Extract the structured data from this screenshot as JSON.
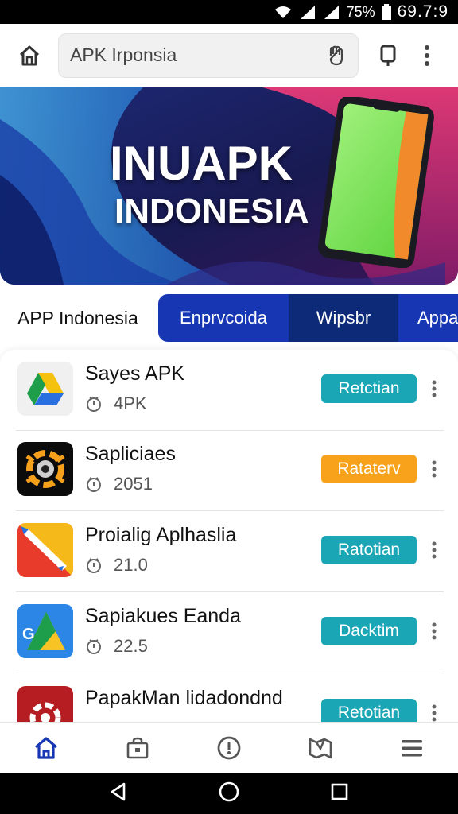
{
  "status_bar": {
    "battery": "75%",
    "time": "69.7:9"
  },
  "browser": {
    "url_text": "APK Irponsia"
  },
  "banner": {
    "title_line1": "INUAPK",
    "title_line2": "INDONESIA",
    "colors": {
      "bg_dark": "#1b1d5c",
      "wave_blue": "#2a8fe0",
      "pink": "#e8306e",
      "phone_screen": "#7fe05c"
    }
  },
  "tabs": {
    "section_label": "APP Indonesia",
    "items": [
      "Enprvcoida",
      "Wipsbr",
      "Appa"
    ]
  },
  "apps": [
    {
      "name": "Sayes APK",
      "meta": "4PK",
      "action": "Retctian",
      "action_color": "#1aa6b5",
      "icon": "drive-triangle-icon"
    },
    {
      "name": "Sapliciaes",
      "meta": "2051",
      "action": "Rataterv",
      "action_color": "#f7a21a",
      "icon": "orange-gear-icon"
    },
    {
      "name": "Proialig Aplhaslia",
      "meta": "21.0",
      "action": "Ratotian",
      "action_color": "#1aa6b5",
      "icon": "pencil-note-icon"
    },
    {
      "name": "Sapiakues Eanda",
      "meta": "22.5",
      "action": "Dacktim",
      "action_color": "#1aa6b5",
      "icon": "maps-g-icon"
    },
    {
      "name": "PapakMan lidadondnd",
      "meta": "",
      "action": "Retotian",
      "action_color": "#1aa6b5",
      "icon": "red-gear-icon"
    }
  ],
  "bottom_nav": [
    "home-icon",
    "shopping-bag-icon",
    "compass-icon",
    "map-icon",
    "hamburger-menu-icon"
  ],
  "colors": {
    "accent_blue": "#1636b4",
    "teal": "#1aa6b5",
    "orange": "#f7a21a"
  }
}
